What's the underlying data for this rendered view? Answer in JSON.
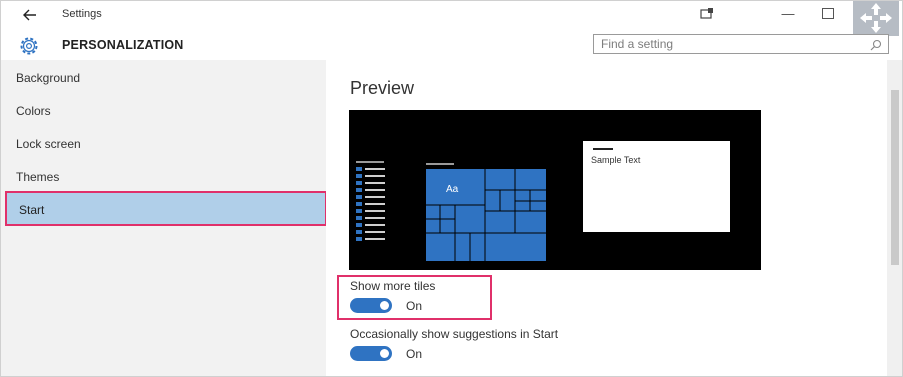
{
  "titlebar": {
    "back_icon": "arrow-left-icon",
    "title": "Settings"
  },
  "header": {
    "section_title": "PERSONALIZATION",
    "search_placeholder": "Find a setting"
  },
  "sidebar": {
    "items": [
      {
        "label": "Background"
      },
      {
        "label": "Colors"
      },
      {
        "label": "Lock screen"
      },
      {
        "label": "Themes"
      },
      {
        "label": "Start",
        "selected": true
      }
    ]
  },
  "main": {
    "preview_title": "Preview",
    "sample_text": "Sample Text",
    "settings": [
      {
        "label": "Show more tiles",
        "state": "On",
        "enabled": true
      },
      {
        "label": "Occasionally show suggestions in Start",
        "state": "On",
        "enabled": true
      }
    ]
  },
  "colors": {
    "accent": "#2f73c2",
    "highlight": "#e0306a",
    "selected_bg": "#b0cfe9"
  }
}
